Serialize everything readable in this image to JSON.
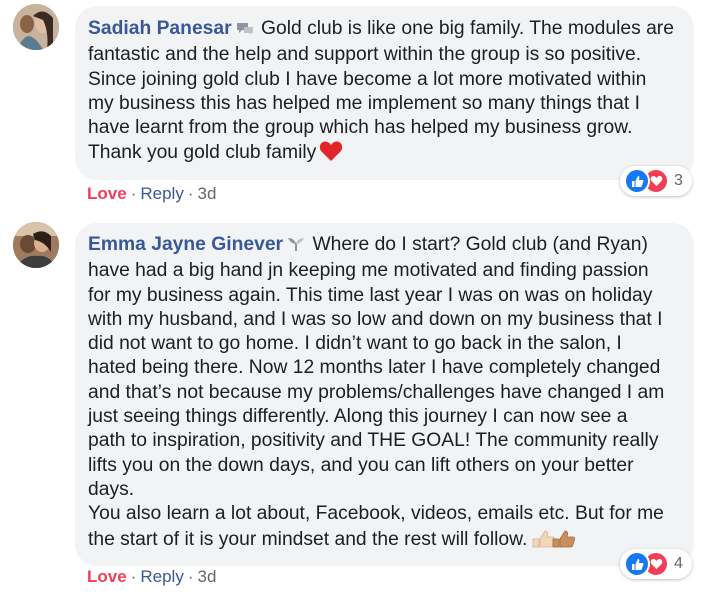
{
  "comments": [
    {
      "author": "Sadiah Panesar",
      "badge_icon": "conversation-starter-icon",
      "lines": [
        "Gold club is like one big family. The modules are",
        "fantastic and the help and support within the group is so positive.",
        "Since joining gold club I have become a lot more motivated within",
        "my business this has helped me implement so many things that I",
        "have learnt from the group which has helped my business grow.",
        "Thank you gold club family"
      ],
      "emoji_icon": "red-heart-icon",
      "actions": {
        "love": "Love",
        "reply": "Reply",
        "time": "3d",
        "separator": "·"
      },
      "reaction_count": "3"
    },
    {
      "author": "Emma Jayne Ginever",
      "badge_icon": "rising-star-icon",
      "lines": [
        "Where do I start? Gold club (and Ryan)",
        "have had a big hand jn keeping me motivated and finding passion",
        "for my business again. This time last year I was on was on holiday",
        "with my husband, and I was so low and down on my business that I",
        "did not want to go home. I didn’t want to go back in the salon, I",
        "hated being there. Now 12 months later I have completely changed",
        "and that’s not because my problems/challenges have changed I am",
        "just seeing things differently. Along this journey I can now see a",
        "path to inspiration, positivity and THE GOAL! The community really",
        "lifts you on the down days, and you can lift others on your better",
        "days.",
        "You also learn a lot about, Facebook, videos, emails etc. But for me",
        "the start of it is your mindset and the rest will follow."
      ],
      "emoji_icon": "thumbs-up-icons",
      "actions": {
        "love": "Love",
        "reply": "Reply",
        "time": "3d",
        "separator": "·"
      },
      "reaction_count": "4"
    }
  ],
  "colors": {
    "author": "#385898",
    "love": "#f33e58",
    "bubble": "#f2f3f5",
    "like": "#1877f2"
  }
}
